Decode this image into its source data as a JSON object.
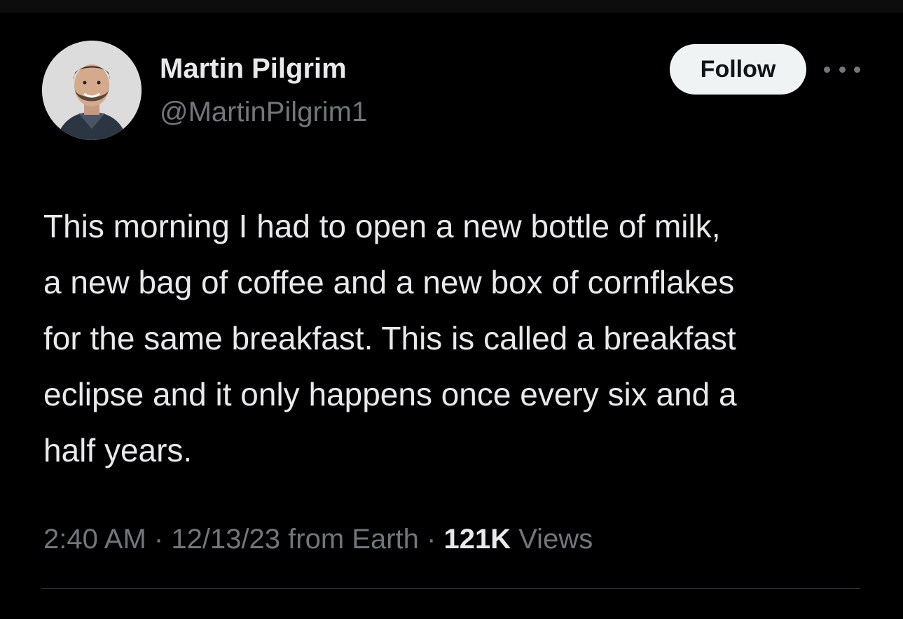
{
  "author": {
    "display_name": "Martin Pilgrim",
    "handle": "@MartinPilgrim1",
    "avatar_icon": "profile-photo"
  },
  "actions": {
    "follow_label": "Follow",
    "more_icon": "ellipsis-icon"
  },
  "tweet": {
    "text_lines": [
      "This morning I had to open a new bottle of milk,",
      "a new bag of coffee and a new box of cornflakes",
      "for the same breakfast. This is called a breakfast",
      "eclipse and it only happens once every six and a",
      "half years."
    ]
  },
  "meta": {
    "time": "2:40 AM",
    "separator": "·",
    "date_source": "12/13/23 from Earth",
    "views_count": "121K",
    "views_label": "Views"
  },
  "colors": {
    "background": "#000000",
    "primary_text": "#e7e9ea",
    "secondary_text": "#71767b",
    "follow_bg": "#eff3f4",
    "divider": "#2f3336"
  }
}
